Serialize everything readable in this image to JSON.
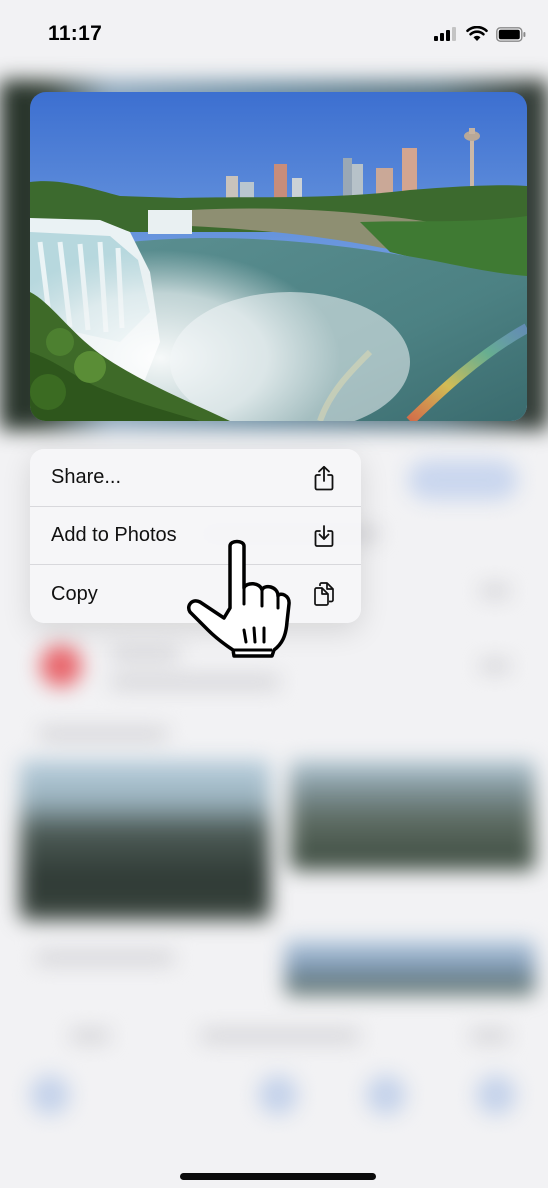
{
  "status_bar": {
    "time": "11:17",
    "icons": [
      "cellular-signal-icon",
      "wifi-icon",
      "battery-icon"
    ]
  },
  "preview": {
    "subject": "waterfall-photo"
  },
  "context_menu": {
    "items": [
      {
        "label": "Share...",
        "icon": "share-icon"
      },
      {
        "label": "Add to Photos",
        "icon": "save-to-photos-icon"
      },
      {
        "label": "Copy",
        "icon": "copy-icon"
      }
    ]
  },
  "overlay": {
    "pointer": "hand-pointer-icon"
  },
  "colors": {
    "menu_background": "#f6f6f8",
    "menu_separator": "#d8d8dc",
    "text": "#111111"
  }
}
